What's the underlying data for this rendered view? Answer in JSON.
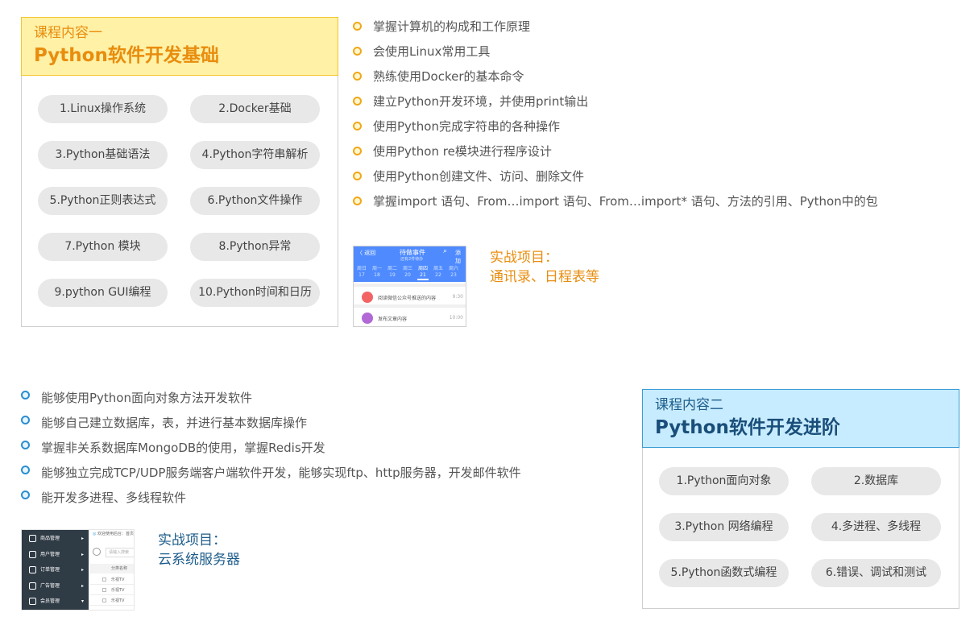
{
  "course1": {
    "subtitle": "课程内容一",
    "title": "Python软件开发基础",
    "modules": [
      "1.Linux操作系统",
      "2.Docker基础",
      "3.Python基础语法",
      "4.Python字符串解析",
      "5.Python正则表达式",
      "6.Python文件操作",
      "7.Python 模块",
      "8.Python异常",
      "9.python GUI编程",
      "10.Python时间和日历"
    ],
    "objectives": [
      "掌握计算机的构成和工作原理",
      "会使用Linux常用工具",
      "熟练使用Docker的基本命令",
      "建立Python开发环境，并使用print输出",
      "使用Python完成字符串的各种操作",
      "使用Python re模块进行程序设计",
      "使用Python创建文件、访问、删除文件",
      "掌握import 语句、From…import 语句、From…import* 语句、方法的引用、Python中的包"
    ],
    "project": {
      "label": "实战项目：",
      "name": "通讯录、日程表等",
      "thumb": {
        "back": "〈 返回",
        "heading": "待做事件",
        "subheading": "还有2件待办",
        "search_icon": "search-icon",
        "add": "添加",
        "days": [
          {
            "w": "周日",
            "d": "17"
          },
          {
            "w": "周一",
            "d": "18"
          },
          {
            "w": "周二",
            "d": "19"
          },
          {
            "w": "周三",
            "d": "20"
          },
          {
            "w": "周四",
            "d": "21"
          },
          {
            "w": "周五",
            "d": "22"
          },
          {
            "w": "周六",
            "d": "23"
          }
        ],
        "items": [
          {
            "text": "阅读微信公众号推送的内容",
            "time": "9:30",
            "color": "#f26464"
          },
          {
            "text": "发布文章内容",
            "time": "10:00",
            "color": "#b269d6"
          }
        ]
      }
    },
    "colors": {
      "accent": "#e88d0e",
      "header_bg": "#fff1a6",
      "bullet": "#f2a716"
    }
  },
  "course2": {
    "subtitle": "课程内容二",
    "title": "Python软件开发进阶",
    "modules": [
      "1.Python面向对象",
      "2.数据库",
      "3.Python 网络编程",
      "4.多进程、多线程",
      "5.Python函数式编程",
      "6.错误、调试和测试"
    ],
    "objectives": [
      "能够使用Python面向对象方法开发软件",
      "能够自己建立数据库，表，并进行基本数据库操作",
      "掌握非关系数据库MongoDB的使用，掌握Redis开发",
      "能够独立完成TCP/UDP服务端客户端软件开发，能够实现ftp、http服务器，开发邮件软件",
      "能开发多进程、多线程软件"
    ],
    "project": {
      "label": "实战项目：",
      "name": "云系统服务器",
      "thumb": {
        "menu": [
          "商品管理",
          "用户管理",
          "订单管理",
          "广告管理",
          "会员管理"
        ],
        "top_text": "欢迎使用后台：首页",
        "search_placeholder": "请输入搜索",
        "col_header": "分类名称",
        "rows": [
          "乐视TV",
          "乐视TV",
          "乐视TV"
        ]
      }
    },
    "colors": {
      "accent": "#1a4e7a",
      "header_bg": "#c8ecff",
      "bullet": "#2b8ed0"
    }
  }
}
